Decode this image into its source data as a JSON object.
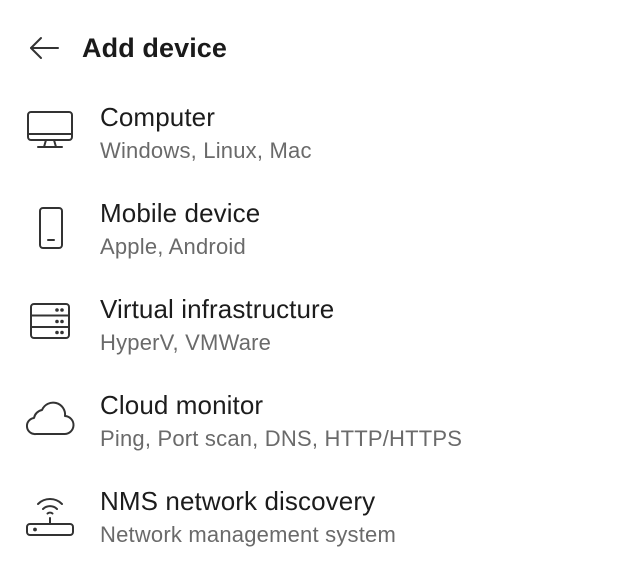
{
  "header": {
    "title": "Add device",
    "back_icon": "arrow-left-icon"
  },
  "items": [
    {
      "title": "Computer",
      "subtitle": "Windows, Linux, Mac",
      "icon": "monitor-icon"
    },
    {
      "title": "Mobile device",
      "subtitle": "Apple, Android",
      "icon": "smartphone-icon"
    },
    {
      "title": "Virtual infrastructure",
      "subtitle": "HyperV, VMWare",
      "icon": "server-icon"
    },
    {
      "title": "Cloud monitor",
      "subtitle": "Ping, Port scan, DNS, HTTP/HTTPS",
      "icon": "cloud-icon"
    },
    {
      "title": "NMS network discovery",
      "subtitle": "Network management system",
      "icon": "router-icon"
    }
  ]
}
